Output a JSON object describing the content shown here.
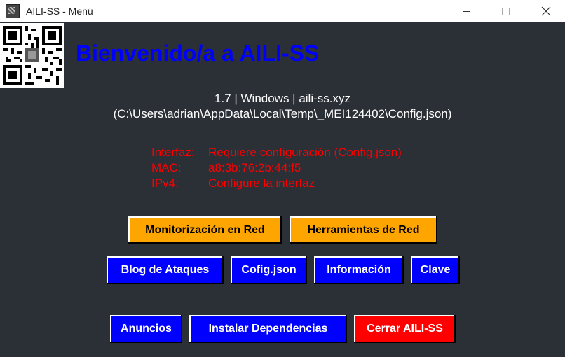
{
  "window": {
    "title": "AILI-SS - Menú"
  },
  "header": {
    "welcome": "Bienvenido/a a AILI-SS"
  },
  "info": {
    "version_line": "1.7  |  Windows  |  aili-ss.xyz",
    "config_path": "(C:\\Users\\adrian\\AppData\\Local\\Temp\\_MEI124402\\Config.json)",
    "rows": [
      {
        "label": "Interfaz:",
        "value": "Requiere configuración (Config.json)"
      },
      {
        "label": "MAC:",
        "value": "a8:3b:76:2b:44:f5"
      },
      {
        "label": "IPv4:",
        "value": "Configure la interfaz"
      }
    ]
  },
  "buttons": {
    "monitorizacion": "Monitorización en Red",
    "herramientas": "Herramientas de Red",
    "blog": "Blog de Ataques",
    "config": "Cofig.json",
    "informacion": "Información",
    "clave": "Clave",
    "anuncios": "Anuncios",
    "instalar": "Instalar Dependencias",
    "cerrar": "Cerrar AILI-SS"
  },
  "colors": {
    "background": "#2b2f36",
    "welcome": "#0000ff",
    "info_text": "#ff0000",
    "orange_button": "#ffa500",
    "blue_button": "#0000ff",
    "red_button": "#ff0000"
  },
  "icons": [
    "app-icon",
    "qr-code-icon",
    "minimize-icon",
    "maximize-icon",
    "close-icon"
  ]
}
